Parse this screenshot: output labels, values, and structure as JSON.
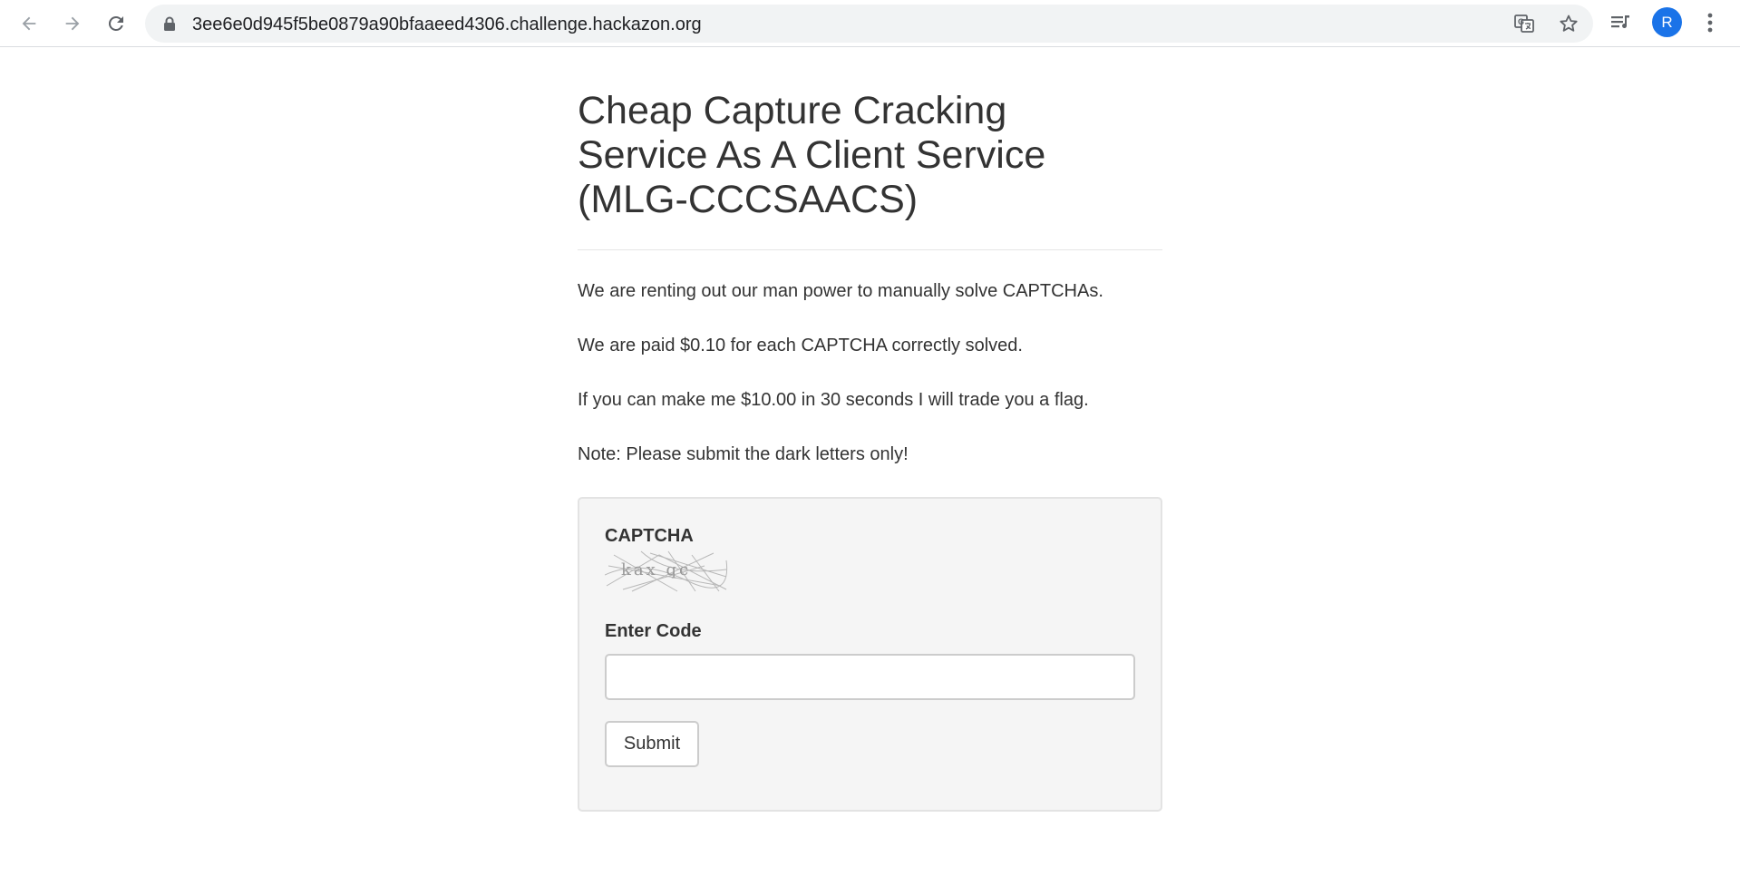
{
  "browser": {
    "url": "3ee6e0d945f5be0879a90bfaaeed4306.challenge.hackazon.org",
    "avatar_initial": "R",
    "icons": [
      "back-arrow-icon",
      "forward-arrow-icon",
      "reload-icon",
      "lock-icon",
      "translate-icon",
      "star-icon",
      "media-queue-icon",
      "kebab-menu-icon"
    ],
    "accent_color": "#1a73e8"
  },
  "page": {
    "title": "Cheap Capture Cracking Service As A Client Service (MLG-CCCSAACS)",
    "paragraphs": [
      "We are renting out our man power to manually solve CAPTCHAs.",
      "We are paid $0.10 for each CAPTCHA correctly solved.",
      "If you can make me $10.00 in 30 seconds I will trade you a flag.",
      "Note: Please submit the dark letters only!"
    ]
  },
  "form": {
    "captcha_label": "CAPTCHA",
    "captcha_text": "kax qc",
    "code_label": "Enter Code",
    "code_value": "",
    "submit_label": "Submit"
  }
}
